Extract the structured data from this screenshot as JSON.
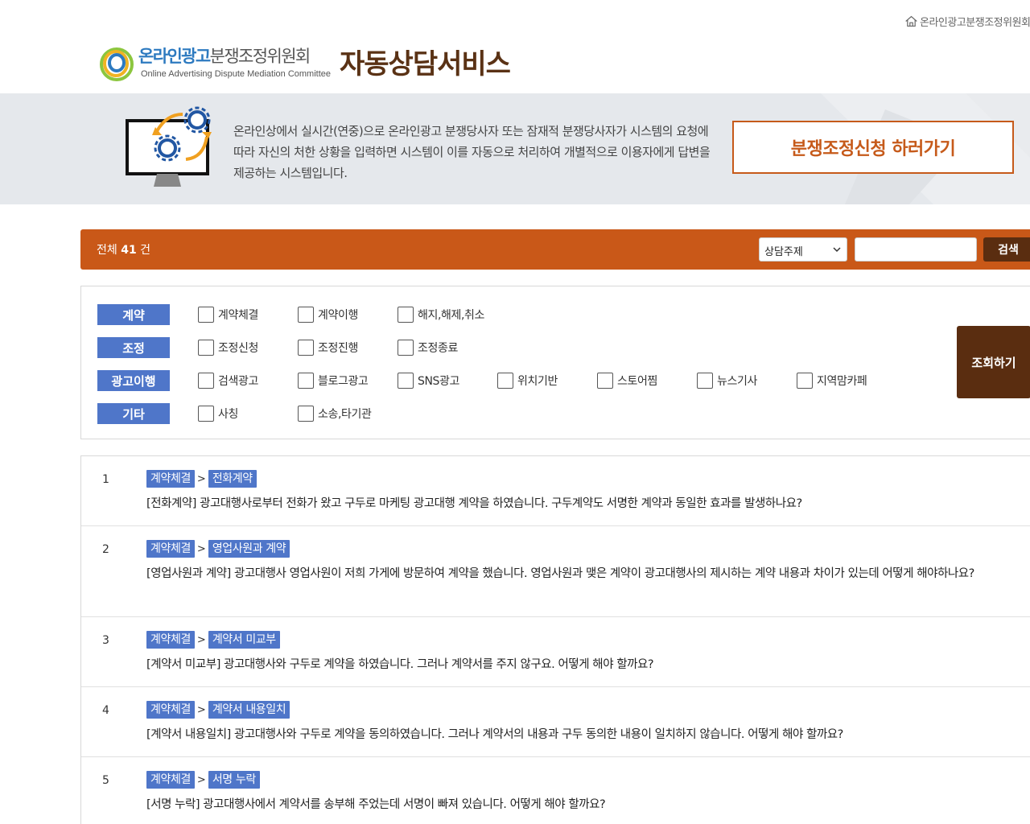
{
  "header": {
    "top_link": "온라인광고분쟁조정위원회",
    "logo_name_part1": "온라인광고",
    "logo_name_part2": "분쟁조정위원회",
    "logo_sub": "Online Advertising Dispute Mediation Committee",
    "service_title": "자동상담서비스"
  },
  "banner": {
    "description": "온라인상에서 실시간(연중)으로 온라인광고 분쟁당사자 또는 잠재적 분쟁당사자가 시스템의 요청에 따라 자신의 처한 상황을 입력하면 시스템이 이를 자동으로 처리하여 개별적으로 이용자에게 답변을 제공하는 시스템입니다.",
    "apply_button": "분쟁조정신청 하러가기"
  },
  "search": {
    "total_prefix": "전체",
    "total_count": "41",
    "total_suffix": "건",
    "select_value": "상담주제",
    "input_value": "",
    "button": "검색"
  },
  "filters": {
    "query_button": "조회하기",
    "rows": [
      {
        "label": "계약",
        "options": [
          "계약체결",
          "계약이행",
          "해지,해제,취소"
        ]
      },
      {
        "label": "조정",
        "options": [
          "조정신청",
          "조정진행",
          "조정종료"
        ]
      },
      {
        "label": "광고이행",
        "options": [
          "검색광고",
          "블로그광고",
          "SNS광고",
          "위치기반",
          "스토어찜",
          "뉴스기사",
          "지역맘카페"
        ]
      },
      {
        "label": "기타",
        "options": [
          "사칭",
          "소송,타기관"
        ]
      }
    ]
  },
  "results": [
    {
      "num": "1",
      "tag1": "계약체결",
      "tag2": "전화계약",
      "question": "[전화계약] 광고대행사로부터 전화가 왔고 구두로 마케팅 광고대행 계약을 하였습니다. 구두계약도 서명한 계약과 동일한 효과를 발생하나요?"
    },
    {
      "num": "2",
      "tag1": "계약체결",
      "tag2": "영업사원과 계약",
      "question": "[영업사원과 계약] 광고대행사 영업사원이 저희 가게에 방문하여 계약을 했습니다. 영업사원과 맺은 계약이 광고대행사의 제시하는 계약 내용과 차이가 있는데 어떻게 해야하나요?"
    },
    {
      "num": "3",
      "tag1": "계약체결",
      "tag2": "계약서 미교부",
      "question": "[계약서 미교부] 광고대행사와 구두로 계약을 하였습니다. 그러나 계약서를 주지 않구요. 어떻게 해야 할까요?"
    },
    {
      "num": "4",
      "tag1": "계약체결",
      "tag2": "계약서 내용일치",
      "question": "[계약서 내용일치] 광고대행사와 구두로 계약을 동의하였습니다. 그러나 계약서의 내용과 구두 동의한 내용이 일치하지 않습니다. 어떻게 해야 할까요?"
    },
    {
      "num": "5",
      "tag1": "계약체결",
      "tag2": "서명 누락",
      "question": "[서명 누락] 광고대행사에서 계약서를 송부해 주었는데 서명이 빠져 있습니다. 어떻게 해야 할까요?"
    }
  ]
}
